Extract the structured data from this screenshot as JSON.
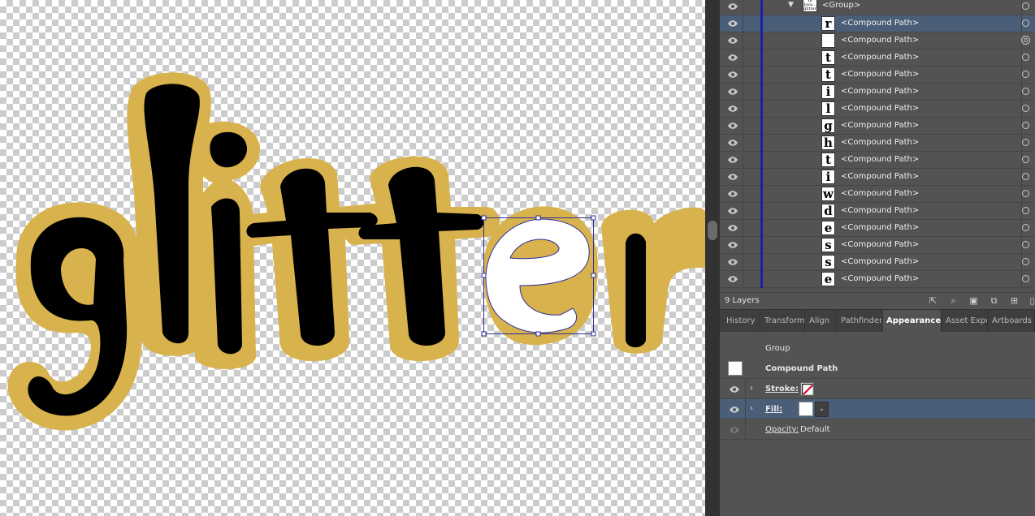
{
  "canvas": {
    "artwork_word": "glitter",
    "colors": {
      "outline": "#d8b24c",
      "letter": "#000000",
      "selected_letter": "#ffffff",
      "selection": "#2d2d9c"
    }
  },
  "layers": {
    "group_row": {
      "name": "<Group>",
      "thumb_text": "In Java... glitter"
    },
    "items": [
      {
        "name": "<Compound Path>",
        "glyph": "r",
        "selected": true,
        "target_active": false
      },
      {
        "name": "<Compound Path>",
        "glyph": "",
        "selected": false,
        "target_active": true
      },
      {
        "name": "<Compound Path>",
        "glyph": "t",
        "selected": false,
        "target_active": false
      },
      {
        "name": "<Compound Path>",
        "glyph": "t",
        "selected": false,
        "target_active": false
      },
      {
        "name": "<Compound Path>",
        "glyph": "i",
        "selected": false,
        "target_active": false
      },
      {
        "name": "<Compound Path>",
        "glyph": "l",
        "selected": false,
        "target_active": false
      },
      {
        "name": "<Compound Path>",
        "glyph": "g",
        "selected": false,
        "target_active": false
      },
      {
        "name": "<Compound Path>",
        "glyph": "h",
        "selected": false,
        "target_active": false
      },
      {
        "name": "<Compound Path>",
        "glyph": "t",
        "selected": false,
        "target_active": false
      },
      {
        "name": "<Compound Path>",
        "glyph": "i",
        "selected": false,
        "target_active": false
      },
      {
        "name": "<Compound Path>",
        "glyph": "w",
        "selected": false,
        "target_active": false
      },
      {
        "name": "<Compound Path>",
        "glyph": "d",
        "selected": false,
        "target_active": false
      },
      {
        "name": "<Compound Path>",
        "glyph": "e",
        "selected": false,
        "target_active": false
      },
      {
        "name": "<Compound Path>",
        "glyph": "s",
        "selected": false,
        "target_active": false
      },
      {
        "name": "<Compound Path>",
        "glyph": "s",
        "selected": false,
        "target_active": false
      },
      {
        "name": "<Compound Path>",
        "glyph": "e",
        "selected": false,
        "target_active": false
      }
    ],
    "count_label": "9 Layers",
    "footer_icons": [
      "export-icon",
      "search-icon",
      "make-clip-icon",
      "move-to-layer-icon",
      "new-layer-icon",
      "delete-icon"
    ]
  },
  "tabs": [
    {
      "label": "History",
      "active": false
    },
    {
      "label": "Transform",
      "active": false
    },
    {
      "label": "Align",
      "active": false
    },
    {
      "label": "Pathfinder",
      "active": false
    },
    {
      "label": "Appearance",
      "active": true
    },
    {
      "label": "Asset Expo",
      "active": false
    },
    {
      "label": "Artboards",
      "active": false
    }
  ],
  "appearance": {
    "group_label": "Group",
    "object_label": "Compound Path",
    "stroke_label": "Stroke:",
    "fill_label": "Fill:",
    "opacity_label": "Opacity:",
    "opacity_value": "Default"
  }
}
